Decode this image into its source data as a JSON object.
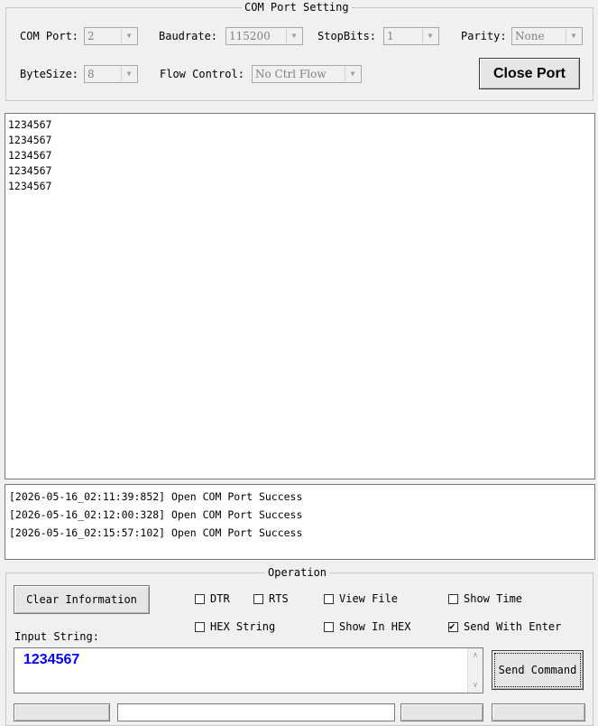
{
  "com_port_setting": {
    "title": "COM Port Setting",
    "com_port": {
      "label": "COM Port:",
      "value": "2"
    },
    "baudrate": {
      "label": "Baudrate:",
      "value": "115200"
    },
    "stop_bits": {
      "label": "StopBits:",
      "value": "1"
    },
    "parity": {
      "label": "Parity:",
      "value": "None"
    },
    "byte_size": {
      "label": "ByteSize:",
      "value": "8"
    },
    "flow_control": {
      "label": "Flow Control:",
      "value": "No Ctrl Flow"
    },
    "close_port_label": "Close Port"
  },
  "receive_area": {
    "lines": [
      "1234567",
      "1234567",
      "1234567",
      "1234567",
      "1234567"
    ]
  },
  "log_area": {
    "lines": [
      "[2026-05-16_02:11:39:852] Open COM Port Success",
      "[2026-05-16_02:12:00:328] Open COM Port Success",
      "[2026-05-16_02:15:57:102] Open COM Port Success"
    ]
  },
  "operation": {
    "title": "Operation",
    "clear_information_label": "Clear Information",
    "input_string_label": "Input String:",
    "input_value": "1234567",
    "send_command_label": "Send Command",
    "checkboxes": {
      "dtr": {
        "label": "DTR",
        "checked": false
      },
      "rts": {
        "label": "RTS",
        "checked": false
      },
      "view_file": {
        "label": "View File",
        "checked": false
      },
      "show_time": {
        "label": "Show Time",
        "checked": false
      },
      "hex_string": {
        "label": "HEX String",
        "checked": false
      },
      "show_in_hex": {
        "label": "Show In HEX",
        "checked": false
      },
      "send_with_enter": {
        "label": "Send With Enter",
        "checked": true
      }
    }
  },
  "icons": {
    "dropdown": "chevron-down-icon",
    "check": "checkmark-icon",
    "scroll_up": "scroll-up-arrow-icon",
    "scroll_down": "scroll-down-arrow-icon"
  },
  "colors": {
    "window_bg": "#f0f0f0",
    "input_text": "#0000ff",
    "disabled_text": "#7f7f7f"
  }
}
